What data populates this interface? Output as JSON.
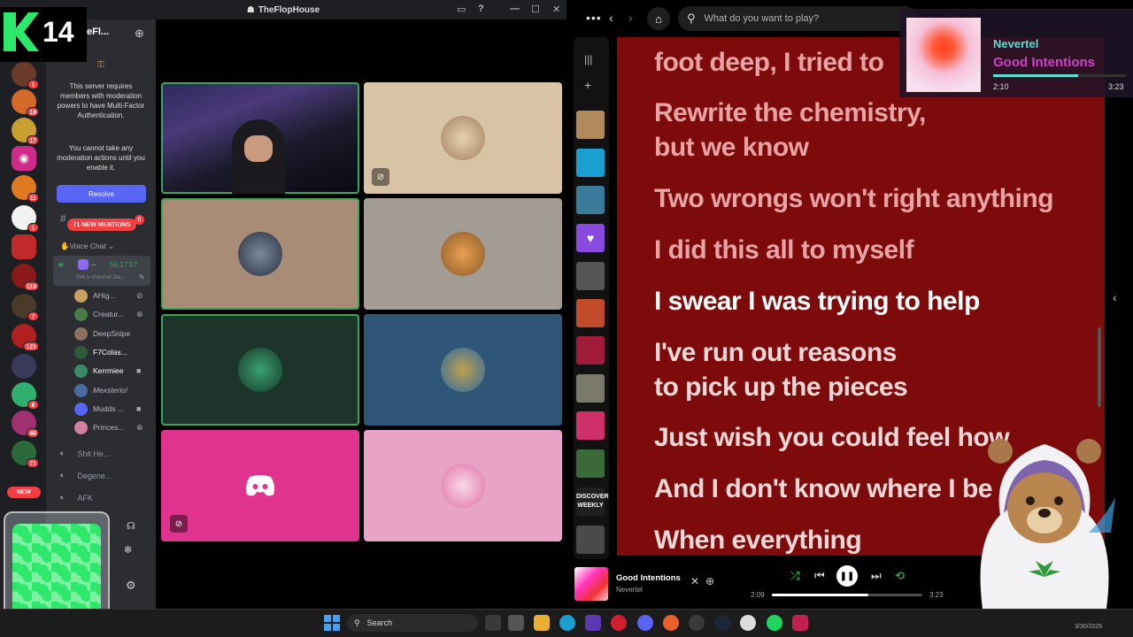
{
  "discord": {
    "window_title": "TheFlopHouse",
    "server_name": "eFl...",
    "streamer_badge": "14",
    "mfa_notice": "This server requires members with moderation powers to have Multi-Factor Authentication.",
    "mfa_notice2": "You cannot take any moderation actions until you enable it.",
    "resolve_label": "Resolve",
    "new_mentions": "71 NEW MENTIONS",
    "voice_category": "Voice Chat",
    "voice_timer": "56:17:57",
    "voice_status": "Set a channel sta...",
    "members": [
      {
        "name": "AHig...",
        "avatar_color": "#c8a060"
      },
      {
        "name": "Creatur...",
        "avatar_color": "#4a7a4a"
      },
      {
        "name": "DeepSnipe",
        "avatar_color": "#8a7060"
      },
      {
        "name": "F7Colas...",
        "avatar_color": "#2e5a3a"
      },
      {
        "name": "Kerrmiee",
        "avatar_color": "#3a8a6a"
      },
      {
        "name": "Mexsterio!",
        "avatar_color": "#4a6aa0"
      },
      {
        "name": "Mudds ...",
        "avatar_color": "#5865f2"
      },
      {
        "name": "Princes...",
        "avatar_color": "#d080a0"
      }
    ],
    "channels": [
      {
        "name": "Shit He..."
      },
      {
        "name": "Degene..."
      },
      {
        "name": "AFK"
      }
    ],
    "rail_badges": [
      "1",
      "19",
      "17",
      "11",
      "1",
      "119",
      "7",
      "121",
      "8",
      "46",
      "71",
      "NEW"
    ],
    "new_label": "NEW"
  },
  "tiles": [
    {
      "kind": "video",
      "bg": "#2a2a46",
      "speaking": true
    },
    {
      "kind": "avatar",
      "bg": "#d8c4a4",
      "avatar": "#b9a080"
    },
    {
      "kind": "avatar",
      "bg": "#a88c76",
      "avatar": "#5a6a7a",
      "speaking": true
    },
    {
      "kind": "avatar",
      "bg": "#a39c94",
      "avatar": "#d97a30"
    },
    {
      "kind": "avatar",
      "bg": "#1c3429",
      "avatar": "#2e6a4a",
      "speaking": true
    },
    {
      "kind": "avatar",
      "bg": "#2f5676",
      "avatar": "#3a8ac0"
    },
    {
      "kind": "discord",
      "bg": "#e0338e"
    },
    {
      "kind": "avatar",
      "bg": "#e8a4c6",
      "avatar": "#f0c0d8"
    }
  ],
  "spotify": {
    "search_placeholder": "What do you want to play?",
    "lyrics": [
      {
        "text": "foot deep, I tried to",
        "state": "past"
      },
      {
        "text": "Rewrite the chemistry,",
        "state": "past"
      },
      {
        "text": "but we know",
        "state": "past"
      },
      {
        "text": "Two wrongs won't right anything",
        "state": "past"
      },
      {
        "text": "I did this all to myself",
        "state": "past"
      },
      {
        "text": "I swear I was trying to help",
        "state": "current"
      },
      {
        "text": "I've run out reasons",
        "state": "future"
      },
      {
        "text": "to pick up the pieces",
        "state": "future"
      },
      {
        "text": "Just wish you could feel how",
        "state": "future"
      },
      {
        "text": "And I don't know where I be",
        "state": "future"
      },
      {
        "text": "When everything",
        "state": "future"
      }
    ],
    "now_playing": {
      "title": "Good Intentions",
      "artist": "Nevertel",
      "current_time": "2:09",
      "total_time": "3:23",
      "progress": 0.64
    }
  },
  "overlay": {
    "artist": "Nevertel",
    "track": "Good Intentions",
    "current_time": "2:10",
    "total_time": "3:23",
    "progress": 0.64
  },
  "taskbar": {
    "search_label": "Search",
    "date": "3/30/2026"
  }
}
